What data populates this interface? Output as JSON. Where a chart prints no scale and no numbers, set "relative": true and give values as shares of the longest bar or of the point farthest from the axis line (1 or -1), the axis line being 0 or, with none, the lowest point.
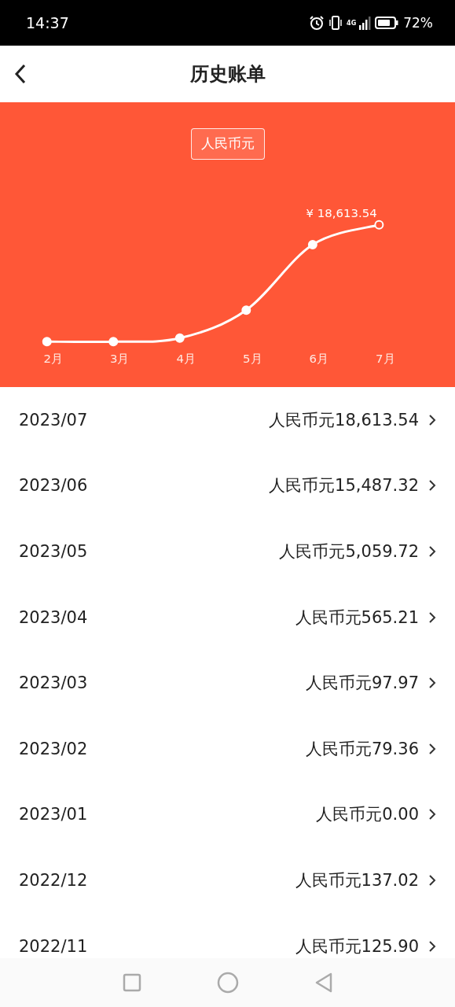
{
  "status_bar": {
    "time": "14:37",
    "network": "4G",
    "battery": "72%"
  },
  "header": {
    "title": "历史账单"
  },
  "currency_badge": "人民币元",
  "chart_data": {
    "type": "line",
    "categories": [
      "2月",
      "3月",
      "4月",
      "5月",
      "6月",
      "7月"
    ],
    "relative": true,
    "series": [
      {
        "color": "#ffffff",
        "marker": "circle",
        "values": [
          0.0,
          0.0,
          0.03,
          0.27,
          0.83,
          1.0
        ]
      }
    ],
    "annotations": [
      "¥ 18,613.54"
    ]
  },
  "bills": [
    {
      "month": "2023/07",
      "amount": "人民币元18,613.54"
    },
    {
      "month": "2023/06",
      "amount": "人民币元15,487.32"
    },
    {
      "month": "2023/05",
      "amount": "人民币元5,059.72"
    },
    {
      "month": "2023/04",
      "amount": "人民币元565.21"
    },
    {
      "month": "2023/03",
      "amount": "人民币元97.97"
    },
    {
      "month": "2023/02",
      "amount": "人民币元79.36"
    },
    {
      "month": "2023/01",
      "amount": "人民币元0.00"
    },
    {
      "month": "2022/12",
      "amount": "人民币元137.02"
    },
    {
      "month": "2022/11",
      "amount": "人民币元125.90"
    }
  ]
}
